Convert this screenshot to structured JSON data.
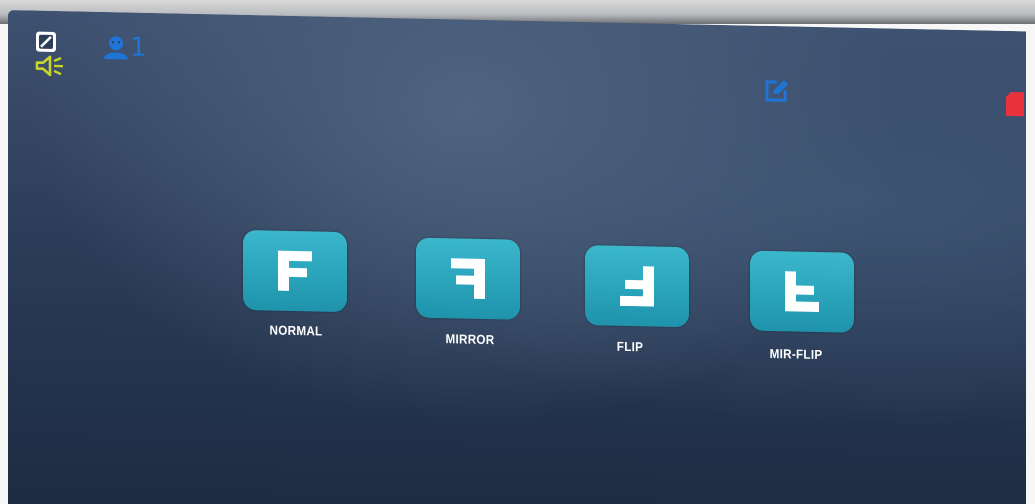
{
  "status_bar": {
    "hdd_icon": "hdd-status-icon",
    "audio_icon": "speaker-icon",
    "user_icon": "user-icon",
    "user_count": "1",
    "edit_icon": "edit-icon",
    "record_icon": "sd-card-icon"
  },
  "modes": [
    {
      "label": "NORMAL",
      "glyph": "F-normal"
    },
    {
      "label": "MIRROR",
      "glyph": "F-mirrored"
    },
    {
      "label": "FLIP",
      "glyph": "F-flipped"
    },
    {
      "label": "MIR-FLIP",
      "glyph": "F-mirror-flipped"
    }
  ],
  "colors": {
    "tile": "#2aa4bb",
    "glyph": "#ffffff",
    "user_icon": "#1f74d8",
    "audio_icon": "#c9d42a",
    "record_icon": "#e8323c"
  }
}
